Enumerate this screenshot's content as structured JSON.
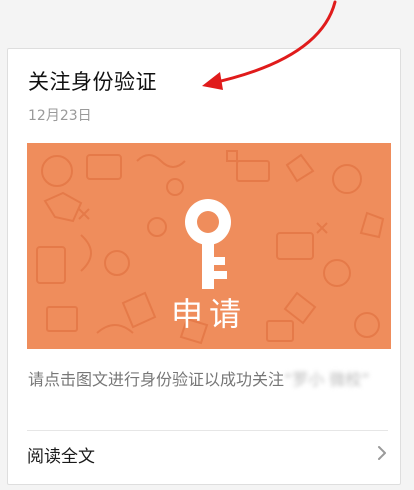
{
  "article": {
    "title": "关注身份验证",
    "date": "12月23日",
    "cover_label": "申请",
    "description": "请点击图文进行身份验证以成功关注",
    "description_blurred": "“罗小\n微校”",
    "read_more": "阅读全文"
  },
  "icons": {
    "cover": "key-icon",
    "read_more": "chevron-right-icon",
    "annotation": "red-arrow-icon"
  },
  "colors": {
    "cover_background": "#ef8d5c",
    "cover_text": "#ffffff",
    "annotation_arrow": "#e01b1b"
  }
}
